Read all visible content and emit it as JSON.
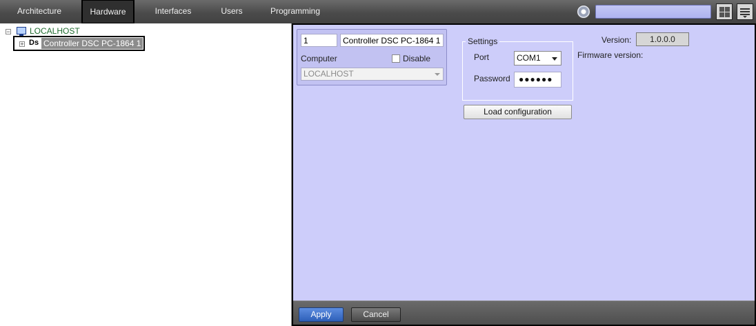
{
  "nav": {
    "tabs": [
      {
        "label": "Architecture"
      },
      {
        "label": "Hardware",
        "active": true
      },
      {
        "label": "Interfaces"
      },
      {
        "label": "Users"
      },
      {
        "label": "Programming"
      }
    ],
    "search": {
      "value": ""
    },
    "icons": [
      "gear-icon",
      "layout-grid-icon",
      "menu-icon"
    ]
  },
  "tree": {
    "root_label": "LOCALHOST",
    "root_expander": "−",
    "child_expander": "+",
    "child_icon_text": "Ds",
    "child_label": "Controller DSC PC-1864 1"
  },
  "object": {
    "id": "1",
    "name": "Controller DSC PC-1864 1",
    "computer_label": "Computer",
    "computer_value": "LOCALHOST",
    "disable_label": "Disable",
    "disable_checked": false
  },
  "settings": {
    "title": "Settings",
    "port_label": "Port",
    "port_value": "COM1",
    "password_label": "Password",
    "password_value": "●●●●●●",
    "load_button": "Load configuration"
  },
  "info": {
    "version_label": "Version:",
    "version_value": "1.0.0.0",
    "firmware_label": "Firmware version:"
  },
  "footer": {
    "apply": "Apply",
    "cancel": "Cancel"
  },
  "colors": {
    "panel_bg": "#cdcdfa",
    "topbar_bg": "#4b4b4b",
    "accent_button": "#2d5fb8",
    "tree_host_text": "#1f6b2e"
  }
}
